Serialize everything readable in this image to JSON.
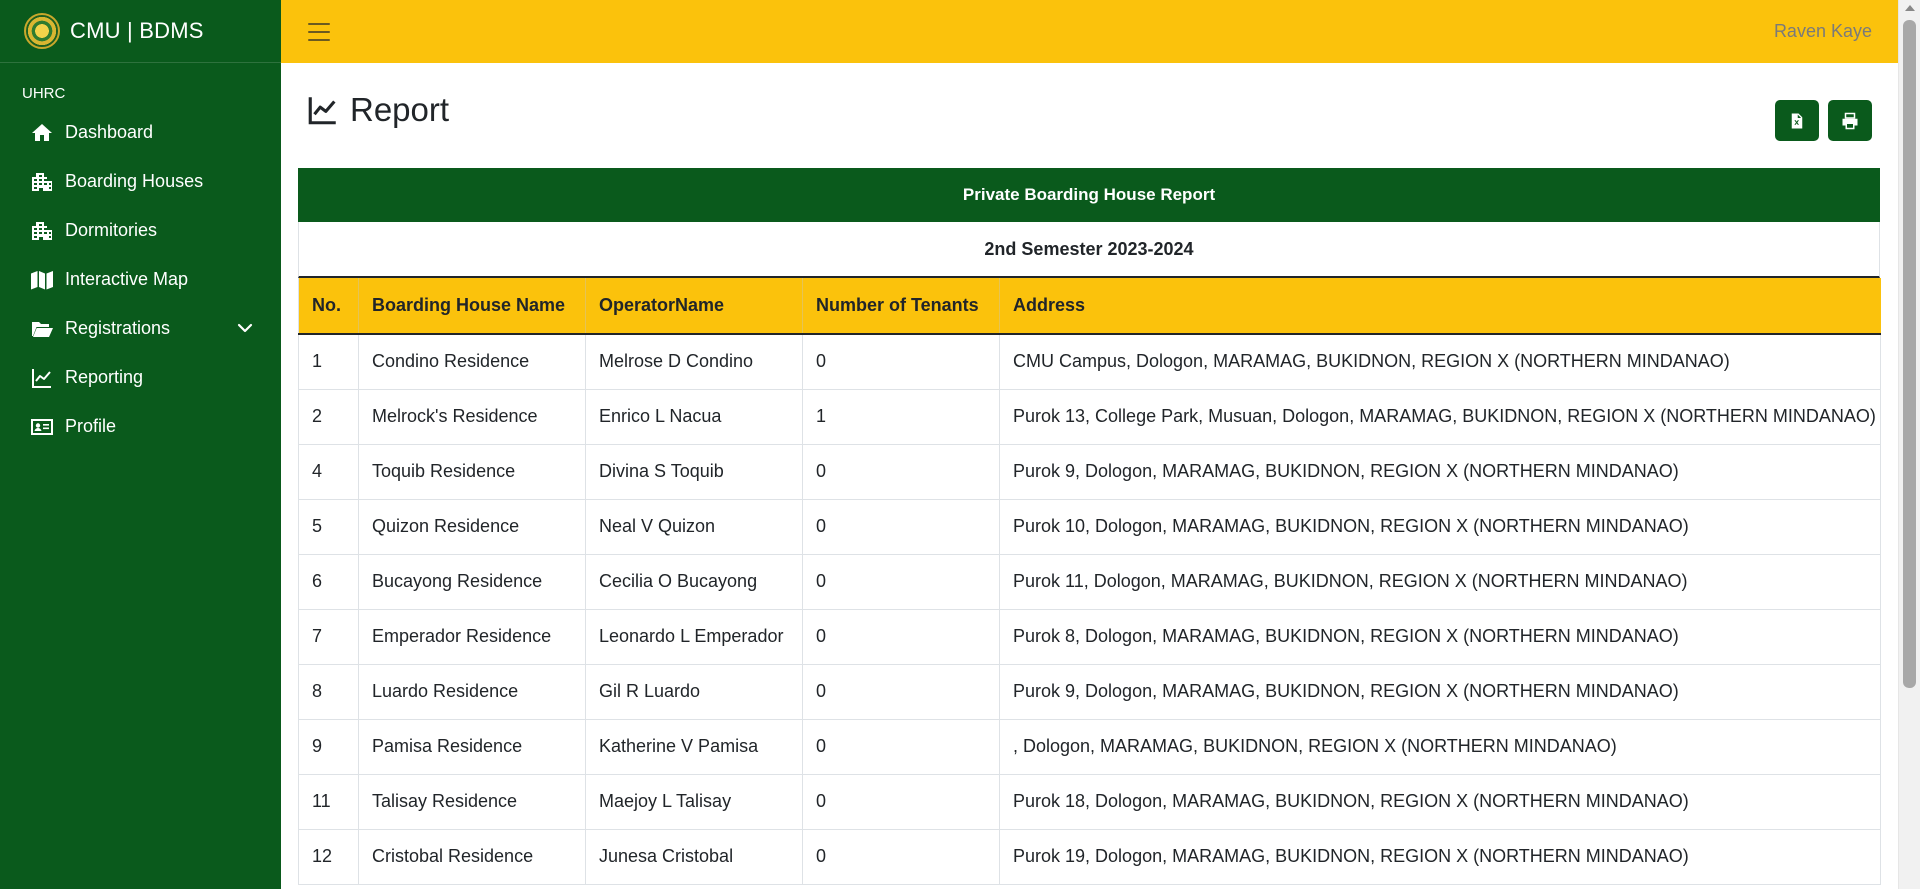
{
  "app": {
    "brand": "CMU | BDMS"
  },
  "sidebar": {
    "section": "UHRC",
    "items": [
      {
        "label": "Dashboard",
        "icon": "home-icon"
      },
      {
        "label": "Boarding Houses",
        "icon": "building-icon"
      },
      {
        "label": "Dormitories",
        "icon": "building-icon"
      },
      {
        "label": "Interactive Map",
        "icon": "map-icon"
      },
      {
        "label": "Registrations",
        "icon": "folder-open-icon"
      },
      {
        "label": "Reporting",
        "icon": "line-chart-icon"
      },
      {
        "label": "Profile",
        "icon": "id-card-icon"
      }
    ]
  },
  "topbar": {
    "username": "Raven Kaye"
  },
  "page": {
    "title": "Report"
  },
  "report": {
    "header": "Private Boarding House Report",
    "subheader": "2nd Semester 2023-2024",
    "columns": [
      "No.",
      "Boarding House Name",
      "OperatorName",
      "Number of Tenants",
      "Address"
    ],
    "rows": [
      [
        "1",
        "Condino Residence",
        "Melrose D Condino",
        "0",
        "CMU Campus, Dologon, MARAMAG, BUKIDNON, REGION X (NORTHERN MINDANAO)"
      ],
      [
        "2",
        "Melrock's Residence",
        "Enrico L Nacua",
        "1",
        "Purok 13, College Park, Musuan, Dologon, MARAMAG, BUKIDNON, REGION X (NORTHERN MINDANAO)"
      ],
      [
        "4",
        "Toquib Residence",
        "Divina S Toquib",
        "0",
        "Purok 9, Dologon, MARAMAG, BUKIDNON, REGION X (NORTHERN MINDANAO)"
      ],
      [
        "5",
        "Quizon Residence",
        "Neal V Quizon",
        "0",
        "Purok 10, Dologon, MARAMAG, BUKIDNON, REGION X (NORTHERN MINDANAO)"
      ],
      [
        "6",
        "Bucayong Residence",
        "Cecilia O Bucayong",
        "0",
        "Purok 11, Dologon, MARAMAG, BUKIDNON, REGION X (NORTHERN MINDANAO)"
      ],
      [
        "7",
        "Emperador Residence",
        "Leonardo L Emperador",
        "0",
        "Purok 8, Dologon, MARAMAG, BUKIDNON, REGION X (NORTHERN MINDANAO)"
      ],
      [
        "8",
        "Luardo Residence",
        "Gil R Luardo",
        "0",
        "Purok 9, Dologon, MARAMAG, BUKIDNON, REGION X (NORTHERN MINDANAO)"
      ],
      [
        "9",
        "Pamisa Residence",
        "Katherine V Pamisa",
        "0",
        ", Dologon, MARAMAG, BUKIDNON, REGION X (NORTHERN MINDANAO)"
      ],
      [
        "11",
        "Talisay Residence",
        "Maejoy L Talisay",
        "0",
        "Purok 18, Dologon, MARAMAG, BUKIDNON, REGION X (NORTHERN MINDANAO)"
      ],
      [
        "12",
        "Cristobal Residence",
        "Junesa Cristobal",
        "0",
        "Purok 19, Dologon, MARAMAG, BUKIDNON, REGION X (NORTHERN MINDANAO)"
      ]
    ]
  },
  "colors": {
    "sidebar": "#0a5a1c",
    "accent": "#fbc20c",
    "button": "#0a5a1c"
  }
}
